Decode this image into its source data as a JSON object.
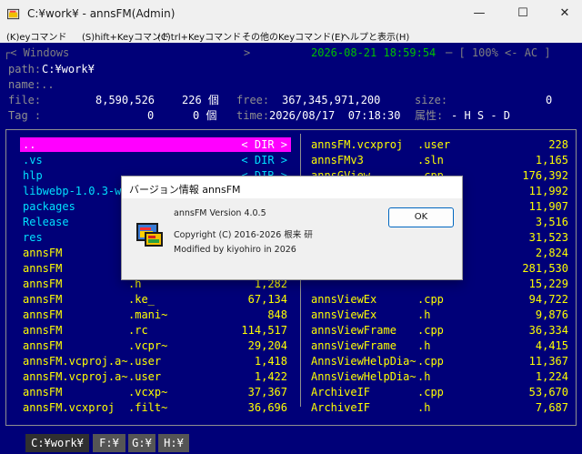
{
  "window": {
    "title": "C:¥work¥ - annsFM(Admin)",
    "min_glyph": "—",
    "max_glyph": "☐",
    "close_glyph": "✕"
  },
  "menu": [
    "(K)eyコマンド",
    "(S)hift+Keyコマンド",
    "(C)trl+Keyコマンド",
    "その他のKeyコマンド(E)",
    "ヘルプと表示(H)"
  ],
  "header": {
    "top_left": "┌< Windows",
    "top_mid": ">",
    "datetime": "2026-08-21 18:59:54",
    "top_right": "─ [ 100% <- AC ]",
    "path_label": "path:",
    "path_value": "C:¥work¥",
    "name_label": "name:..",
    "file_label": "file:",
    "file_bytes": "8,590,526",
    "file_count": "226 個",
    "free_label": "free:",
    "free_value": "367,345,971,200",
    "size_label": "size:",
    "size_value": "0",
    "tag_label": "Tag :",
    "tag_bytes": "0",
    "tag_count": "0 個",
    "time_label": "time:",
    "time_value": "2026/08/17  07:18:30",
    "attr_label": "属性:",
    "attr_value": "- H S - D"
  },
  "left_files": [
    {
      "name": "..",
      "ext": "",
      "size": "< DIR >",
      "color": "white",
      "selected": true
    },
    {
      "name": ".vs",
      "ext": "",
      "size": "< DIR >",
      "color": "cyan"
    },
    {
      "name": "hlp",
      "ext": "",
      "size": "< DIR >",
      "color": "cyan"
    },
    {
      "name": "libwebp-1.0.3-w",
      "ext": "",
      "size": "",
      "color": "cyan"
    },
    {
      "name": "packages",
      "ext": "",
      "size": "",
      "color": "cyan"
    },
    {
      "name": "Release",
      "ext": "",
      "size": "",
      "color": "cyan"
    },
    {
      "name": "res",
      "ext": "",
      "size": "",
      "color": "cyan"
    },
    {
      "name": "annsFM",
      "ext": "",
      "size": "",
      "color": "yellow"
    },
    {
      "name": "annsFM",
      "ext": "",
      "size": "",
      "color": "yellow"
    },
    {
      "name": "annsFM",
      "ext": ".h",
      "size": "1,282",
      "color": "yellow"
    },
    {
      "name": "annsFM",
      "ext": ".ke_",
      "size": "67,134",
      "color": "yellow"
    },
    {
      "name": "annsFM",
      "ext": ".mani~",
      "size": "848",
      "color": "yellow"
    },
    {
      "name": "annsFM",
      "ext": ".rc",
      "size": "114,517",
      "color": "yellow"
    },
    {
      "name": "annsFM",
      "ext": ".vcpr~",
      "size": "29,204",
      "color": "yellow"
    },
    {
      "name": "annsFM.vcproj.a~",
      "ext": ".user",
      "size": "1,418",
      "color": "yellow"
    },
    {
      "name": "annsFM.vcproj.a~",
      "ext": ".user",
      "size": "1,422",
      "color": "yellow"
    },
    {
      "name": "annsFM",
      "ext": ".vcxp~",
      "size": "37,367",
      "color": "yellow"
    },
    {
      "name": "annsFM.vcxproj",
      "ext": ".filt~",
      "size": "36,696",
      "color": "yellow"
    }
  ],
  "right_files": [
    {
      "name": "annsFM.vcxproj",
      "ext": ".user",
      "size": "228"
    },
    {
      "name": "annsFMv3",
      "ext": ".sln",
      "size": "1,165"
    },
    {
      "name": "annsGView",
      "ext": ".cpp",
      "size": "176,392"
    },
    {
      "name": "",
      "ext": "",
      "size": "11,992"
    },
    {
      "name": "",
      "ext": "",
      "size": "11,907"
    },
    {
      "name": "",
      "ext": "",
      "size": "3,516"
    },
    {
      "name": "",
      "ext": "",
      "size": "31,523"
    },
    {
      "name": "",
      "ext": "",
      "size": "2,824"
    },
    {
      "name": "",
      "ext": "",
      "size": "281,530"
    },
    {
      "name": "",
      "ext": "",
      "size": "15,229"
    },
    {
      "name": "annsViewEx",
      "ext": ".cpp",
      "size": "94,722"
    },
    {
      "name": "annsViewEx",
      "ext": ".h",
      "size": "9,876"
    },
    {
      "name": "annsViewFrame",
      "ext": ".cpp",
      "size": "36,334"
    },
    {
      "name": "annsViewFrame",
      "ext": ".h",
      "size": "4,415"
    },
    {
      "name": "AnnsViewHelpDia~",
      "ext": ".cpp",
      "size": "11,367"
    },
    {
      "name": "AnnsViewHelpDia~",
      "ext": ".h",
      "size": "1,224"
    },
    {
      "name": "ArchiveIF",
      "ext": ".cpp",
      "size": "53,670"
    },
    {
      "name": "ArchiveIF",
      "ext": ".h",
      "size": "7,687"
    }
  ],
  "drives": [
    "C:¥work¥",
    "F:¥",
    "G:¥",
    "H:¥"
  ],
  "dialog": {
    "title": "バージョン情報 annsFM",
    "version": "annsFM Version 4.0.5",
    "copyright": "Copyright (C) 2016-2026 根来  研",
    "modified": "Modified by kiyohiro in 2026",
    "ok_label": "OK"
  },
  "colors": {
    "terminal_bg": "#000078",
    "selection": "#ff00ff",
    "file_yellow": "#ffff00",
    "dir_cyan": "#00e0ff",
    "datetime_green": "#00c000"
  }
}
